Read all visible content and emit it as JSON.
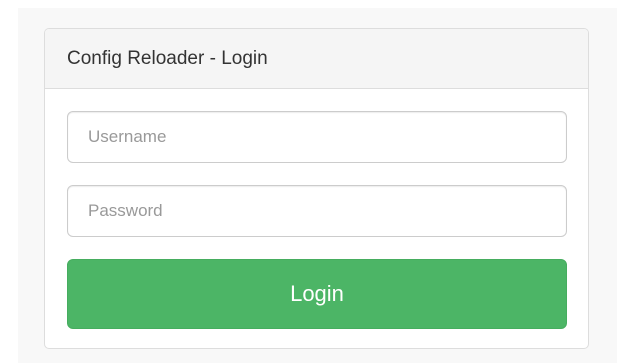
{
  "panel": {
    "title": "Config Reloader - Login"
  },
  "form": {
    "username": {
      "value": "",
      "placeholder": "Username"
    },
    "password": {
      "value": "",
      "placeholder": "Password"
    },
    "login_label": "Login"
  },
  "colors": {
    "button_bg": "#4cb566",
    "heading_bg": "#f5f5f5",
    "border": "#dddddd"
  }
}
